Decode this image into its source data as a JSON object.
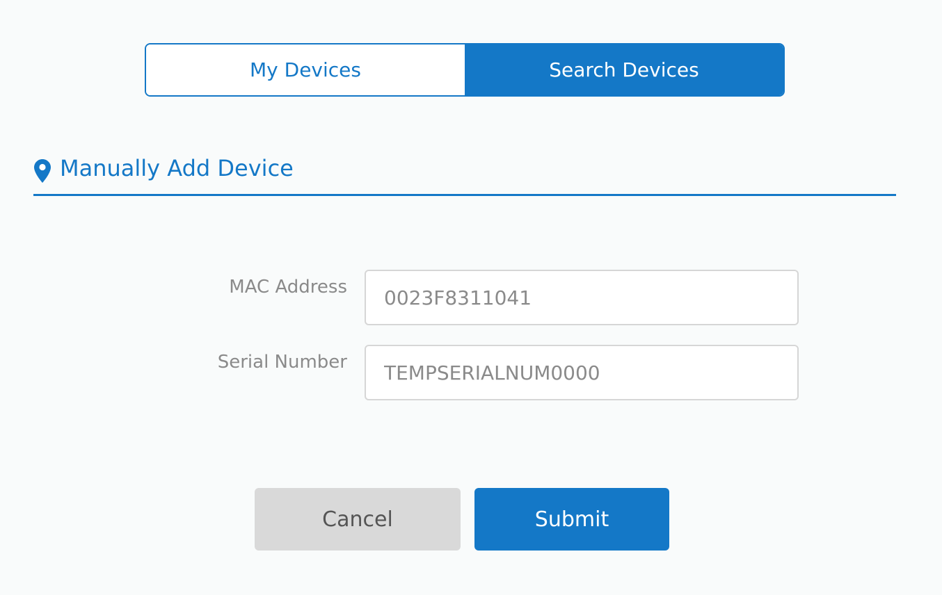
{
  "colors": {
    "accent": "#1478c7",
    "background": "#f9fbfb",
    "label_text": "#8a8a8a",
    "cancel_bg": "#d9d9d9"
  },
  "tabs": {
    "my_devices": "My Devices",
    "search_devices": "Search Devices",
    "active": "search_devices"
  },
  "section": {
    "icon": "location-pin-icon",
    "title": "Manually Add Device"
  },
  "form": {
    "mac": {
      "label": "MAC Address",
      "value": "0023F8311041"
    },
    "serial": {
      "label": "Serial Number",
      "value": "TEMPSERIALNUM0000"
    }
  },
  "actions": {
    "cancel_label": "Cancel",
    "submit_label": "Submit"
  }
}
